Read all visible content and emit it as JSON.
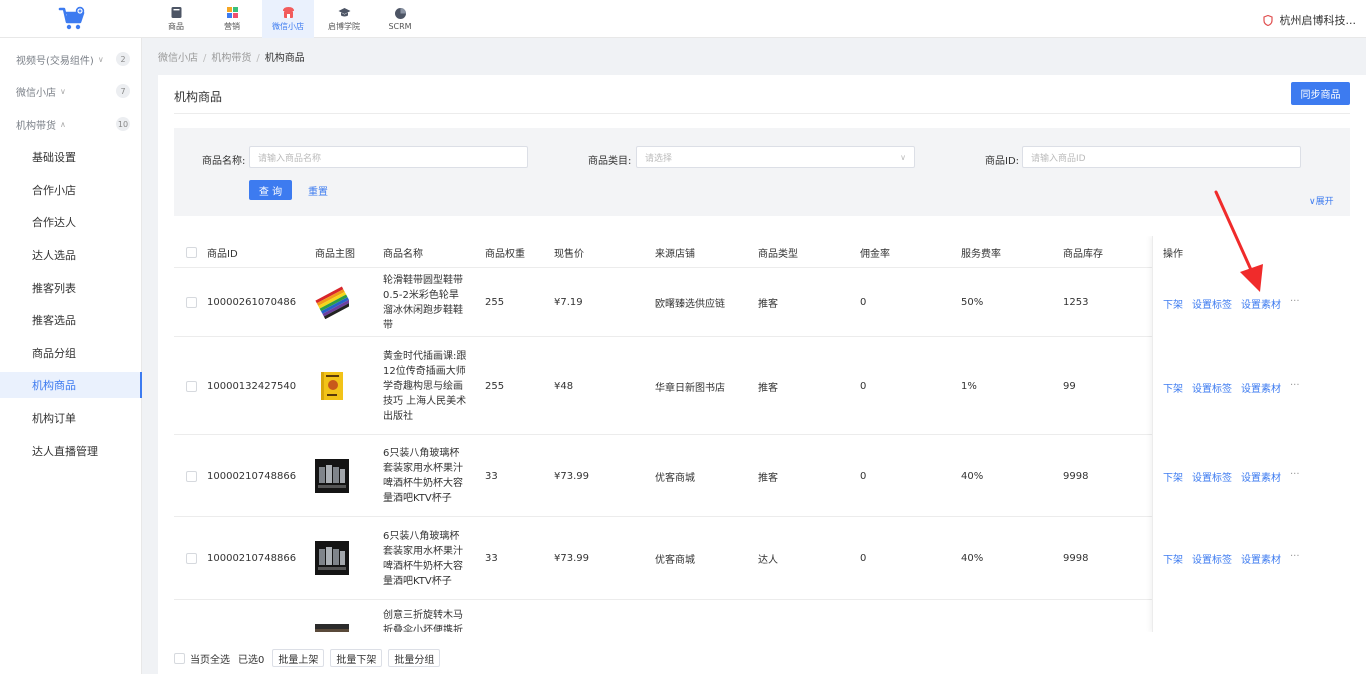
{
  "topnav": [
    {
      "label": "商品",
      "icon": "goods-icon",
      "active": false
    },
    {
      "label": "营销",
      "icon": "grid-icon",
      "active": false
    },
    {
      "label": "微信小店",
      "icon": "shop-icon",
      "active": true
    },
    {
      "label": "启博学院",
      "icon": "graduation-cap-icon",
      "active": false
    },
    {
      "label": "SCRM",
      "icon": "pie-chart-icon",
      "active": false
    }
  ],
  "company": "杭州启博科技...",
  "sidebar": {
    "groups": [
      {
        "label": "视频号(交易组件)",
        "count": "2"
      },
      {
        "label": "微信小店",
        "count": "7"
      },
      {
        "label": "机构带货",
        "count": "10"
      }
    ],
    "items": [
      "基础设置",
      "合作小店",
      "合作达人",
      "达人选品",
      "推客列表",
      "推客选品",
      "商品分组",
      "机构商品",
      "机构订单",
      "达人直播管理"
    ],
    "active_item": "机构商品"
  },
  "breadcrumb": [
    "微信小店",
    "机构带货",
    "机构商品"
  ],
  "panel_title": "机构商品",
  "sync_button": "同步商品",
  "filter": {
    "name_label": "商品名称:",
    "name_placeholder": "请输入商品名称",
    "category_label": "商品类目:",
    "category_placeholder": "请选择",
    "id_label": "商品ID:",
    "id_placeholder": "请输入商品ID",
    "query_button": "查 询",
    "reset_button": "重置",
    "expand": "展开"
  },
  "table": {
    "columns": [
      "商品ID",
      "商品主图",
      "商品名称",
      "商品权重",
      "现售价",
      "来源店铺",
      "商品类型",
      "佣金率",
      "服务费率",
      "商品库存",
      "操作"
    ],
    "rows": [
      {
        "id": "10000261070486",
        "name": "轮滑鞋带圆型鞋带0.5-2米彩色轮旱溜冰休闲跑步鞋鞋带",
        "weight": "255",
        "price": "¥7.19",
        "shop": "欧曙臻选供应链",
        "type": "推客",
        "commission": "0",
        "service_fee": "50%",
        "stock": "1253",
        "image": "rainbow-shoelaces"
      },
      {
        "id": "10000132427540",
        "name": "黄金时代插画课:跟12位传奇插画大师学奇趣构思与绘画技巧 上海人民美术出版社",
        "weight": "255",
        "price": "¥48",
        "shop": "华章日新图书店",
        "type": "推客",
        "commission": "0",
        "service_fee": "1%",
        "stock": "99",
        "image": "yellow-book"
      },
      {
        "id": "10000210748866",
        "name": "6只装八角玻璃杯套装家用水杯果汁啤酒杯牛奶杯大容量酒吧KTV杯子",
        "weight": "33",
        "price": "¥73.99",
        "shop": "优客商城",
        "type": "推客",
        "commission": "0",
        "service_fee": "40%",
        "stock": "9998",
        "image": "glass-cups"
      },
      {
        "id": "10000210748866",
        "name": "6只装八角玻璃杯套装家用水杯果汁啤酒杯牛奶杯大容量酒吧KTV杯子",
        "weight": "33",
        "price": "¥73.99",
        "shop": "优客商城",
        "type": "达人",
        "commission": "0",
        "service_fee": "40%",
        "stock": "9998",
        "image": "glass-cups"
      },
      {
        "id": "",
        "name": "创意三折旋转木马折叠伞小坏便携折",
        "weight": "",
        "price": "",
        "shop": "",
        "type": "",
        "commission": "",
        "service_fee": "",
        "stock": "",
        "image": "umbrella"
      }
    ],
    "row_actions": [
      "下架",
      "设置标签",
      "设置素材",
      "···"
    ]
  },
  "footer": {
    "select_all": "当页全选",
    "selected": "已选0",
    "buttons": [
      "批量上架",
      "批量下架",
      "批量分组"
    ]
  },
  "colors": {
    "accent": "#3d7bf0",
    "annotation_arrow": "#f02b2b"
  }
}
